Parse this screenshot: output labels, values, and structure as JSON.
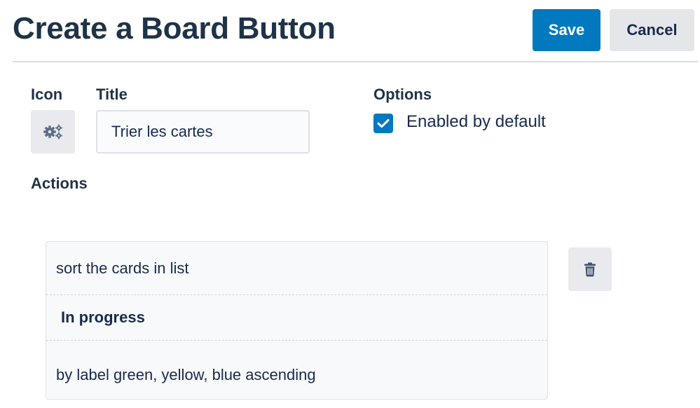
{
  "header": {
    "title": "Create a Board Button",
    "save_label": "Save",
    "cancel_label": "Cancel"
  },
  "form": {
    "icon_label": "Icon",
    "icon_name": "gears-icon",
    "title_label": "Title",
    "title_value": "Trier les cartes",
    "options_label": "Options",
    "options": [
      {
        "label": "Enabled by default",
        "checked": true
      }
    ],
    "actions_label": "Actions"
  },
  "actions": [
    {
      "line1": "sort the cards in list",
      "list_name": "In progress",
      "line3": "by label green, yellow, blue ascending"
    }
  ],
  "colors": {
    "primary": "#0079bf",
    "heading": "#1f3347",
    "button_neutral": "#e4e6ea"
  }
}
